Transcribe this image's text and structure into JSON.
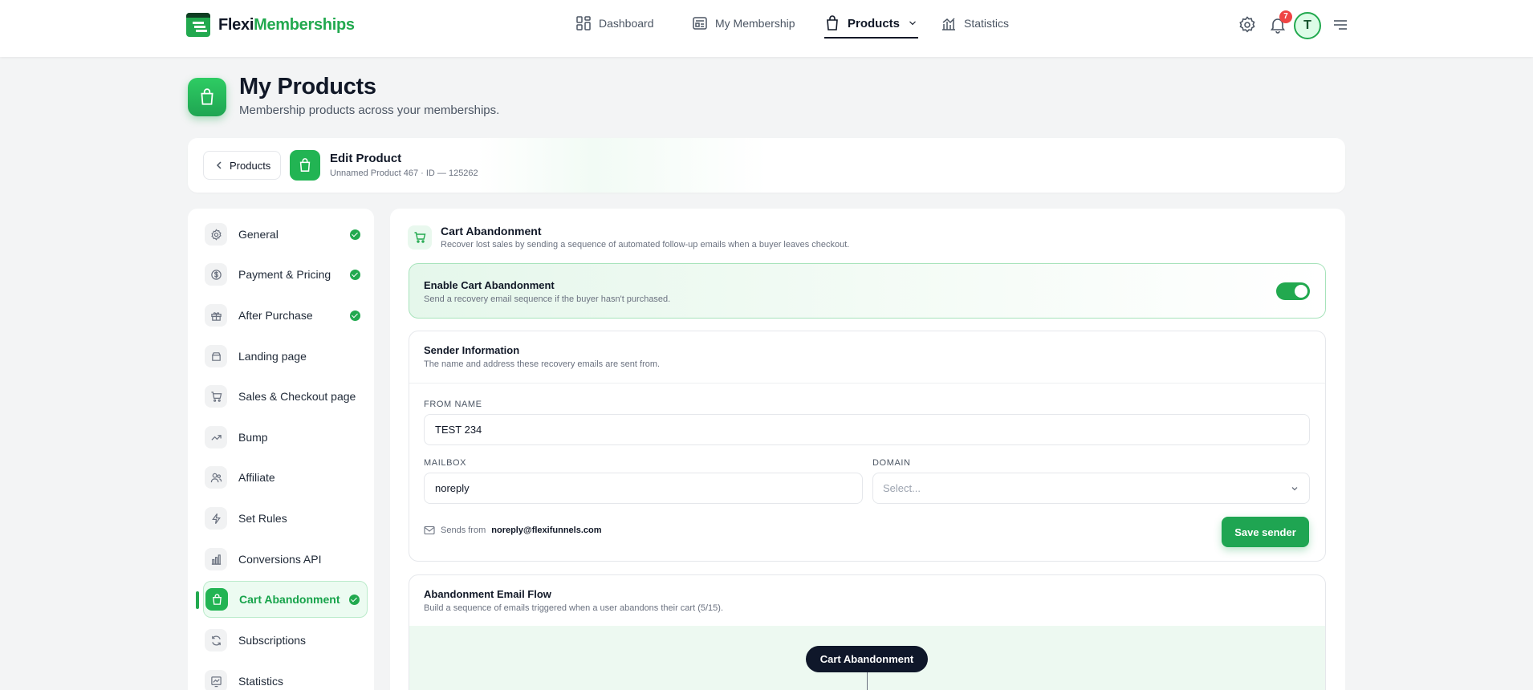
{
  "app": {
    "logo_part1": "Flexi",
    "logo_part2": "Memberships",
    "brand_color": "#22a94f"
  },
  "nav": {
    "dashboard": "Dashboard",
    "my_membership": "My Membership",
    "products": "Products",
    "statistics": "Statistics",
    "active": "Products",
    "notifications_count": "7",
    "avatar_initial": "T"
  },
  "header": {
    "title": "My Products",
    "subtitle": "Membership products across your memberships."
  },
  "edit": {
    "back_label": "Products",
    "title": "Edit Product",
    "subtitle": "Unnamed Product 467 · ID — 125262"
  },
  "sidebar": {
    "items": [
      {
        "label": "General",
        "icon": "gear-icon",
        "done": true
      },
      {
        "label": "Payment & Pricing",
        "icon": "dollar-icon",
        "done": true
      },
      {
        "label": "After Purchase",
        "icon": "gift-icon",
        "done": true
      },
      {
        "label": "Landing page",
        "icon": "page-icon",
        "done": false
      },
      {
        "label": "Sales & Checkout page",
        "icon": "cart-icon",
        "done": false
      },
      {
        "label": "Bump",
        "icon": "trend-icon",
        "done": false
      },
      {
        "label": "Affiliate",
        "icon": "users-icon",
        "done": false
      },
      {
        "label": "Set Rules",
        "icon": "bolt-icon",
        "done": false
      },
      {
        "label": "Conversions API",
        "icon": "bar-chart-icon",
        "done": false
      },
      {
        "label": "Cart Abandonment",
        "icon": "bag-icon",
        "done": true,
        "active": true
      },
      {
        "label": "Subscriptions",
        "icon": "refresh-icon",
        "done": false
      },
      {
        "label": "Statistics",
        "icon": "stats-icon",
        "done": false
      }
    ]
  },
  "section": {
    "title": "Cart Abandonment",
    "subtitle": "Recover lost sales by sending a sequence of automated follow-up emails when a buyer leaves checkout."
  },
  "enable": {
    "title": "Enable Cart Abandonment",
    "subtitle": "Send a recovery email sequence if the buyer hasn't purchased.",
    "enabled": true
  },
  "sender": {
    "title": "Sender Information",
    "subtitle": "The name and address these recovery emails are sent from.",
    "from_name_label": "FROM NAME",
    "from_name_value": "TEST 234",
    "mailbox_label": "MAILBOX",
    "mailbox_value": "noreply",
    "domain_label": "DOMAIN",
    "domain_placeholder": "Select...",
    "sends_from_label": "Sends from",
    "sends_from_value": "noreply@flexifunnels.com",
    "save_label": "Save sender"
  },
  "flow": {
    "title": "Abandonment Email Flow",
    "subtitle": "Build a sequence of emails triggered when a user abandons their cart (5/15).",
    "node_label": "Cart Abandonment"
  }
}
